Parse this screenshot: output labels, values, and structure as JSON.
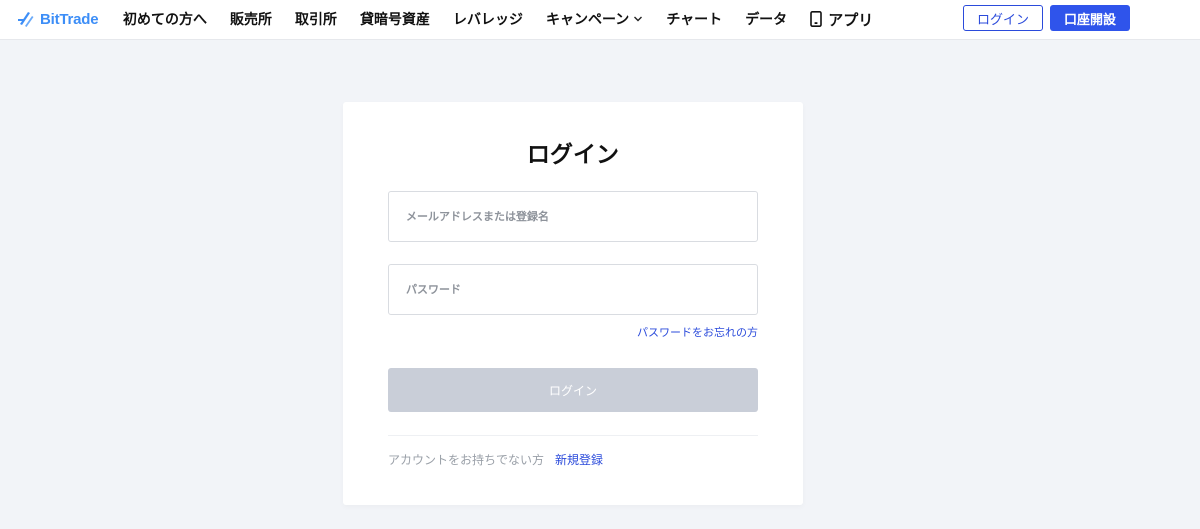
{
  "header": {
    "logo_text": "BitTrade",
    "nav": [
      {
        "label": "初めての方へ"
      },
      {
        "label": "販売所"
      },
      {
        "label": "取引所"
      },
      {
        "label": "貸暗号資産"
      },
      {
        "label": "レバレッジ"
      },
      {
        "label": "キャンペーン",
        "icon": "chevron-down-icon"
      },
      {
        "label": "チャート"
      },
      {
        "label": "データ"
      },
      {
        "label": "アプリ",
        "icon": "smartphone-icon"
      }
    ],
    "login_label": "ログイン",
    "register_label": "口座開設"
  },
  "login_form": {
    "title": "ログイン",
    "email_placeholder": "メールアドレスまたは登録名",
    "email_value": "",
    "password_placeholder": "パスワード",
    "password_value": "",
    "forgot_label": "パスワードをお忘れの方",
    "submit_label": "ログイン",
    "no_account_text": "アカウントをお持ちでない方",
    "signup_label": "新規登録"
  },
  "colors": {
    "brand": "#3d8ef7",
    "accent": "#2f54eb",
    "link": "#2b4bdb",
    "disabled_button": "#c9ced8",
    "page_background": "#f2f4f8"
  }
}
